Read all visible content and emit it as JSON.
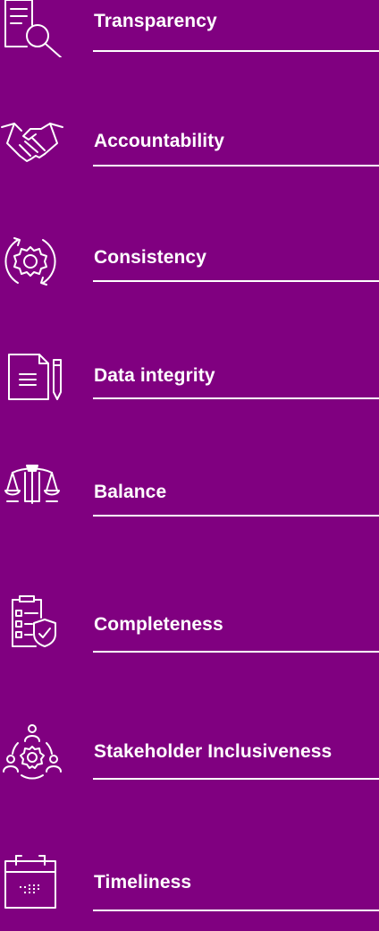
{
  "items": [
    {
      "label": "Transparency",
      "icon": "document-magnifier-icon"
    },
    {
      "label": "Accountability",
      "icon": "handshake-icon"
    },
    {
      "label": "Consistency",
      "icon": "gear-cycle-icon"
    },
    {
      "label": "Data integrity",
      "icon": "document-pen-icon"
    },
    {
      "label": "Balance",
      "icon": "scales-icon"
    },
    {
      "label": "Completeness",
      "icon": "checklist-shield-icon"
    },
    {
      "label": "Stakeholder Inclusiveness",
      "icon": "people-gear-icon"
    },
    {
      "label": "Timeliness",
      "icon": "calendar-icon"
    }
  ],
  "colors": {
    "background": "#800080",
    "foreground": "#ffffff"
  }
}
